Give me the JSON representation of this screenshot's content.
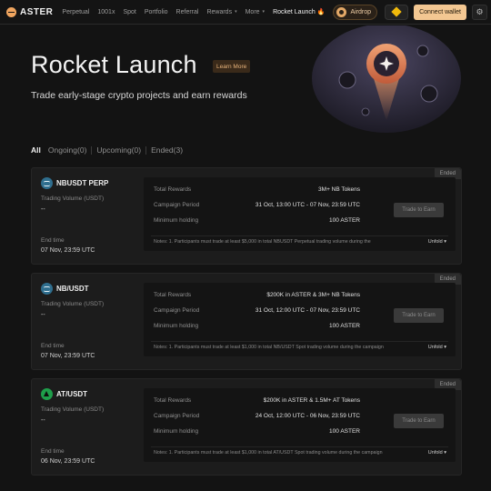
{
  "nav": {
    "logo": "ASTER",
    "links": [
      {
        "label": "Perpetual",
        "caret": false
      },
      {
        "label": "1001x",
        "caret": false
      },
      {
        "label": "Spot",
        "caret": false
      },
      {
        "label": "Portfolio",
        "caret": false
      },
      {
        "label": "Referral",
        "caret": false
      },
      {
        "label": "Rewards",
        "caret": true
      },
      {
        "label": "More",
        "caret": true
      }
    ],
    "active_link": "Rocket Launch",
    "airdrop": "Airdrop",
    "connect": "Connect wallet",
    "icons": {
      "settings": "gear-icon",
      "chain": "bnb-icon",
      "flame": "flame-icon"
    }
  },
  "hero": {
    "title": "Rocket Launch",
    "learn_more": "Learn More",
    "subtitle": "Trade early-stage crypto projects and earn rewards"
  },
  "tabs": [
    {
      "label": "All",
      "active": true
    },
    {
      "label": "Ongoing(0)",
      "active": false
    },
    {
      "label": "Upcoming(0)",
      "active": false
    },
    {
      "label": "Ended(3)",
      "active": false
    }
  ],
  "row_labels": {
    "volume": "Trading Volume (USDT)",
    "end_time": "End time",
    "total_rewards": "Total Rewards",
    "campaign_period": "Campaign Period",
    "min_holding": "Minimum holding",
    "trade_btn": "Trade to Earn",
    "unfold": "Unfold"
  },
  "campaigns": [
    {
      "status": "Ended",
      "pair": "NBUSDT PERP",
      "token_icon": "nb",
      "volume": "--",
      "end_time": "07 Nov, 23:59 UTC",
      "total_rewards": "3M+ NB Tokens",
      "campaign_period": "31 Oct, 13:00 UTC - 07 Nov, 23:59 UTC",
      "min_holding": "100 ASTER",
      "notes": "Notes: 1. Participants must trade at least $5,000 in total NBUSDT Perpetual trading volume during the"
    },
    {
      "status": "Ended",
      "pair": "NB/USDT",
      "token_icon": "nb",
      "volume": "--",
      "end_time": "07 Nov, 23:59 UTC",
      "total_rewards": "$200K in ASTER & 3M+ NB Tokens",
      "campaign_period": "31 Oct, 12:00 UTC - 07 Nov, 23:59 UTC",
      "min_holding": "100 ASTER",
      "notes": "Notes: 1. Participants must trade at least $1,000 in total NB/USDT Spot trading volume during the campaign"
    },
    {
      "status": "Ended",
      "pair": "AT/USDT",
      "token_icon": "at",
      "volume": "--",
      "end_time": "06 Nov, 23:59 UTC",
      "total_rewards": "$200K in ASTER & 1.5M+ AT Tokens",
      "campaign_period": "24 Oct, 12:00 UTC - 06 Nov, 23:59 UTC",
      "min_holding": "100 ASTER",
      "notes": "Notes: 1. Participants must trade at least $1,000 in total AT/USDT Spot trading volume during the campaign"
    }
  ],
  "colors": {
    "accent": "#f3c792",
    "bg": "#131313",
    "card": "#1c1c1c"
  }
}
